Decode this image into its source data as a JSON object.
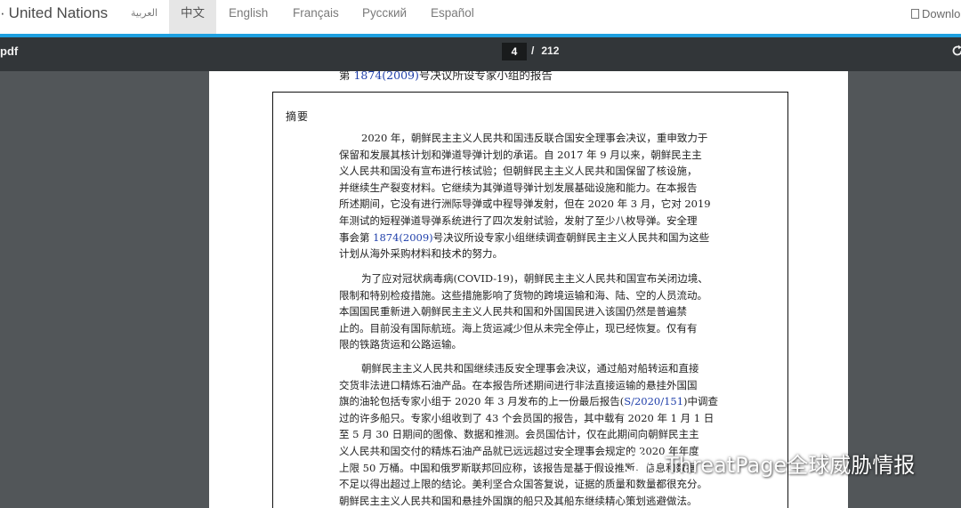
{
  "language_bar": {
    "site_title": "United Nations",
    "languages": [
      {
        "label": "العربية",
        "active": false
      },
      {
        "label": "中文",
        "active": true
      },
      {
        "label": "English",
        "active": false
      },
      {
        "label": "Français",
        "active": false
      },
      {
        "label": "Русский",
        "active": false
      },
      {
        "label": "Español",
        "active": false
      }
    ],
    "download_label": "Downlo",
    "accent_color": "#1ea0e0"
  },
  "pdf_toolbar": {
    "filename": "pdf",
    "current_page": "4",
    "separator": "/",
    "total_pages": "212",
    "rotate_icon": "rotate-icon"
  },
  "document": {
    "running_header": {
      "prefix": "第 ",
      "link": "1874(2009)",
      "suffix": "号决议所设专家小组的报告"
    },
    "summary_heading": "摘要",
    "paragraphs": [
      {
        "lines": [
          "2020 年，朝鲜民主主义人民共和国违反联合国安全理事会决议，重申致力于",
          "保留和发展其核计划和弹道导弹计划的承诺。自 2017 年 9 月以来，朝鲜民主主",
          "义人民共和国没有宣布进行核试验；但朝鲜民主主义人民共和国保留了核设施，",
          "并继续生产裂变材料。它继续为其弹道导弹计划发展基础设施和能力。在本报告",
          "所述期间，它没有进行洲际导弹或中程导弹发射，但在 2020 年 3 月，它对 2019",
          "年测试的短程弹道导弹系统进行了四次发射试验，发射了至少八枚导弹。安全理"
        ],
        "link_line": {
          "prefix": "事会第 ",
          "link": "1874(2009)",
          "suffix": "号决议所设专家小组继续调查朝鲜民主主义人民共和国为这些"
        },
        "last_line": "计划从海外采购材料和技术的努力。"
      },
      {
        "lines": [
          "为了应对冠状病毒病(COVID-19)，朝鲜民主主义人民共和国宣布关闭边境、",
          "限制和特别检疫措施。这些措施影响了货物的跨境运输和海、陆、空的人员流动。",
          "本国国民重新进入朝鲜民主主义人民共和国和外国国民进入该国仍然是普遍禁",
          "止的。目前没有国际航班。海上货运减少但从未完全停止，现已经恢复。仅有有",
          "限的铁路货运和公路运输。"
        ]
      },
      {
        "lines_before": [
          "朝鲜民主主义人民共和国继续违反安全理事会决议，通过船对船转运和直接",
          "交货非法进口精炼石油产品。在本报告所述期间进行非法直接运输的悬挂外国国"
        ],
        "link_line": {
          "prefix": "旗的油轮包括专家小组于 2020 年 3 月发布的上一份最后报告(",
          "link": "S/2020/151",
          "suffix": ")中调查"
        },
        "lines_after": [
          "过的许多船只。专家小组收到了 43 个会员国的报告，其中载有 2020 年 1 月 1 日",
          "至 5 月 30 日期间的图像、数据和推测。会员国估计，仅在此期间向朝鲜民主主",
          "义人民共和国交付的精炼石油产品就已远远超过安全理事会规定的 2020 年年度",
          "上限 50 万桶。中国和俄罗斯联邦回应称，该报告是基于假设推断，信息和数据",
          "不足以得出超过上限的结论。美利坚合众国答复说，证据的质量和数量都很充分。",
          "朝鲜民主主义人民共和国和悬挂外国旗的船只及其船东继续精心策划逃避做法。"
        ]
      }
    ]
  },
  "watermark": {
    "text": "ThreatPage全球威胁情报",
    "icon": "wechat-icon"
  }
}
